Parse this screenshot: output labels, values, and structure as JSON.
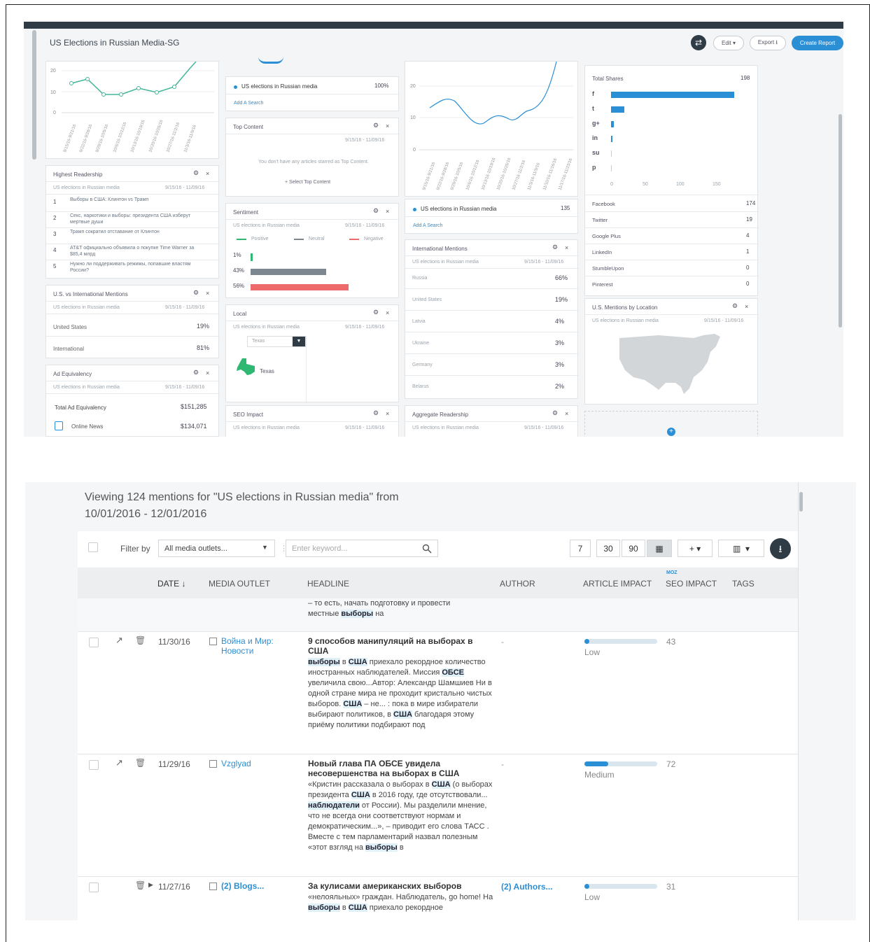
{
  "dashboard": {
    "title": "US Elections in Russian Media-SG",
    "header": {
      "edit": "Edit ▾",
      "export": "Export ⭳",
      "create_report": "Create Report"
    },
    "chart1": {
      "y_ticks": [
        "20",
        "10",
        "0"
      ],
      "x_ticks": [
        "9/15/16-9/21/16",
        "9/22/16-9/28/16",
        "9/29/16-10/5/16",
        "10/6/16-10/12/16",
        "10/13/16-10/19/16",
        "10/20/16-10/26/16",
        "10/27/16-11/2/16",
        "11/3/16-11/9/16"
      ]
    },
    "search_card": {
      "search_name": "US elections in Russian media",
      "search_pct": "100%",
      "add": "Add A Search"
    },
    "top_content": {
      "title": "Top Content",
      "date": "9/15/16 - 11/09/16",
      "empty": "You don't have any articles starred as Top Content.",
      "select": "+ Select Top Content"
    },
    "highest_readership": {
      "title": "Highest Readership",
      "subtitle": "US elections in Russian media",
      "date": "9/15/16 - 11/09/16",
      "items": [
        {
          "n": "1",
          "text": "Выборы в США: Клинтон vs Трамп"
        },
        {
          "n": "2",
          "text": "Секс, наркотики и выборы: президента США изберут мертвые души"
        },
        {
          "n": "3",
          "text": "Трамп сократил отставание от Клинтон"
        },
        {
          "n": "4",
          "text": "AT&T официально объявила о покупке Time Warner за $85,4 млрд"
        },
        {
          "n": "5",
          "text": "Нужно ли поддерживать режимы, попавшие властям России?"
        }
      ]
    },
    "sentiment": {
      "title": "Sentiment",
      "subtitle": "US elections in Russian media",
      "date": "9/15/16 - 11/09/16",
      "legend": [
        "Positive",
        "Neutral",
        "Negative"
      ],
      "values": [
        {
          "label": "1%",
          "frac": 0.01,
          "color": "#2eb872"
        },
        {
          "label": "43%",
          "frac": 0.43,
          "color": "#7d8790"
        },
        {
          "label": "56%",
          "frac": 0.56,
          "color": "#ee6a6a"
        }
      ]
    },
    "us_vs_intl": {
      "title": "U.S. vs International Mentions",
      "subtitle": "US elections in Russian media",
      "date": "9/15/16 - 11/09/16",
      "rows": [
        {
          "label": "United States",
          "value": "19%"
        },
        {
          "label": "International",
          "value": "81%"
        }
      ]
    },
    "local": {
      "title": "Local",
      "subtitle": "US elections in Russian media",
      "date": "9/15/16 - 11/09/16",
      "select": "Texas",
      "state": "Texas"
    },
    "ad_equiv": {
      "title": "Ad Equivalency",
      "subtitle": "US elections in Russian media",
      "date": "9/15/16 - 11/09/16",
      "total_label": "Total Ad Equivalency",
      "total": "$151,285",
      "online_label": "Online News",
      "online": "$134,071"
    },
    "seo": {
      "title": "SEO Impact",
      "subtitle": "US elections in Russian media",
      "date": "9/15/16 - 11/09/16"
    },
    "chart2": {
      "y_ticks": [
        "20",
        "10",
        "0"
      ],
      "x_ticks": [
        "9/15/16-9/21/16",
        "9/22/16-9/28/16",
        "9/29/16-10/5/16",
        "10/6/16-10/12/16",
        "10/13/16-10/19/16",
        "10/20/16-10/26/16",
        "10/27/16-11/2/16",
        "11/3/16-11/9/16",
        "11/10/16-11/16/16",
        "11/17/16-11/23/16"
      ],
      "search_name": "US elections in Russian media",
      "count": "135",
      "add": "Add A Search"
    },
    "intl_mentions": {
      "title": "International Mentions",
      "subtitle": "US elections in Russian media",
      "date": "9/15/16 - 11/09/16",
      "rows": [
        {
          "label": "Russia",
          "value": "66%"
        },
        {
          "label": "United States",
          "value": "19%"
        },
        {
          "label": "Latvia",
          "value": "4%"
        },
        {
          "label": "Ukraine",
          "value": "3%"
        },
        {
          "label": "Germany",
          "value": "3%"
        },
        {
          "label": "Belarus",
          "value": "2%"
        }
      ]
    },
    "agg_readership": {
      "title": "Aggregate Readership",
      "subtitle": "US elections in Russian media",
      "date": "9/15/16 - 11/09/16"
    },
    "shares": {
      "title": "Total Shares",
      "total": "198",
      "x_ticks": [
        "0",
        "50",
        "100",
        "150"
      ],
      "bars": [
        {
          "icon": "f",
          "value": 174
        },
        {
          "icon": "t",
          "value": 19
        },
        {
          "icon": "g+",
          "value": 4
        },
        {
          "icon": "in",
          "value": 1
        },
        {
          "icon": "su",
          "value": 0
        },
        {
          "icon": "p",
          "value": 0
        }
      ],
      "rows": [
        {
          "label": "Facebook",
          "value": "174"
        },
        {
          "label": "Twitter",
          "value": "19"
        },
        {
          "label": "Google Plus",
          "value": "4"
        },
        {
          "label": "LinkedIn",
          "value": "1"
        },
        {
          "label": "StumbleUpon",
          "value": "0"
        },
        {
          "label": "Pinterest",
          "value": "0"
        }
      ]
    },
    "us_location": {
      "title": "U.S. Mentions by Location",
      "subtitle": "US elections in Russian media",
      "date": "9/15/16 - 11/09/16"
    }
  },
  "mentions": {
    "title_line1": "Viewing 124 mentions for \"US elections in Russian media\" from",
    "title_line2": "10/01/2016 - 12/01/2016",
    "filter_label": "Filter by",
    "filter_value": "All media outlets...",
    "keyword_placeholder": "Enter keyword...",
    "ranges": [
      "7",
      "30",
      "90"
    ],
    "columns": {
      "date": "DATE ↓",
      "outlet": "MEDIA OUTLET",
      "headline": "HEADLINE",
      "author": "AUTHOR",
      "impact": "ARTICLE IMPACT",
      "seo_tag": "MOZ",
      "seo": "SEO IMPACT",
      "tags": "TAGS"
    },
    "partial_snippet": [
      "– то есть, начать подготовку и провести",
      "местные ",
      "выборы",
      " на"
    ],
    "rows": [
      {
        "date": "11/30/16",
        "outlet": "Война и Мир: Новости",
        "headline": "9 способов манипуляций на выборах в США",
        "snippet": "<span class=\"hl\">выборы</span> в <span class=\"hl\">США</span> приехало рекордное количество иностранных наблюдателей. Миссия <span class=\"hl\">ОБСЕ</span> увеличила свою...Автор: Александр Шамшиев Ни в одной стране мира не проходит кристально чистых выборов. <span class=\"hl\">США</span> – не... : пока в мире избиратели выбирают политиков, в <span class=\"hl\">США</span> благодаря этому приёму политики подбирают под",
        "author": "-",
        "impact": "Low",
        "impact_frac": 0.05,
        "seo": "43"
      },
      {
        "date": "11/29/16",
        "outlet": "Vzglyad",
        "headline": "Новый глава ПА ОБСЕ увидела несовершенства на выборах в США",
        "snippet": "«Кристин рассказала о выборах в <span class=\"hl\">США</span> (о выборах президента <span class=\"hl\">США</span> в 2016 году, где отсутствовали... <span class=\"hl\">наблюдатели</span> от России). Мы разделили мнение, что не всегда они соответствуют нормам и демократическим...», – приводит его слова ТАСС . Вместе с тем парламентарий назвал полезным «этот взгляд на <span class=\"hl\">выборы</span> в",
        "author": "-",
        "impact": "Medium",
        "impact_frac": 0.33,
        "seo": "72"
      },
      {
        "date": "11/27/16",
        "outlet": "(2) Blogs...",
        "headline": "За кулисами американских выборов",
        "snippet": "«нелояльных» граждан. Наблюдатель, go home! На <span class=\"hl\">выборы</span> в <span class=\"hl\">США</span> приехало рекордное",
        "author": "(2) Authors...",
        "impact": "Low",
        "impact_frac": 0.04,
        "seo": "31"
      }
    ]
  },
  "colors": {
    "accent": "#2b8fd6",
    "dark": "#2f3b45",
    "positive": "#2eb872",
    "negative": "#ee6a6a"
  }
}
